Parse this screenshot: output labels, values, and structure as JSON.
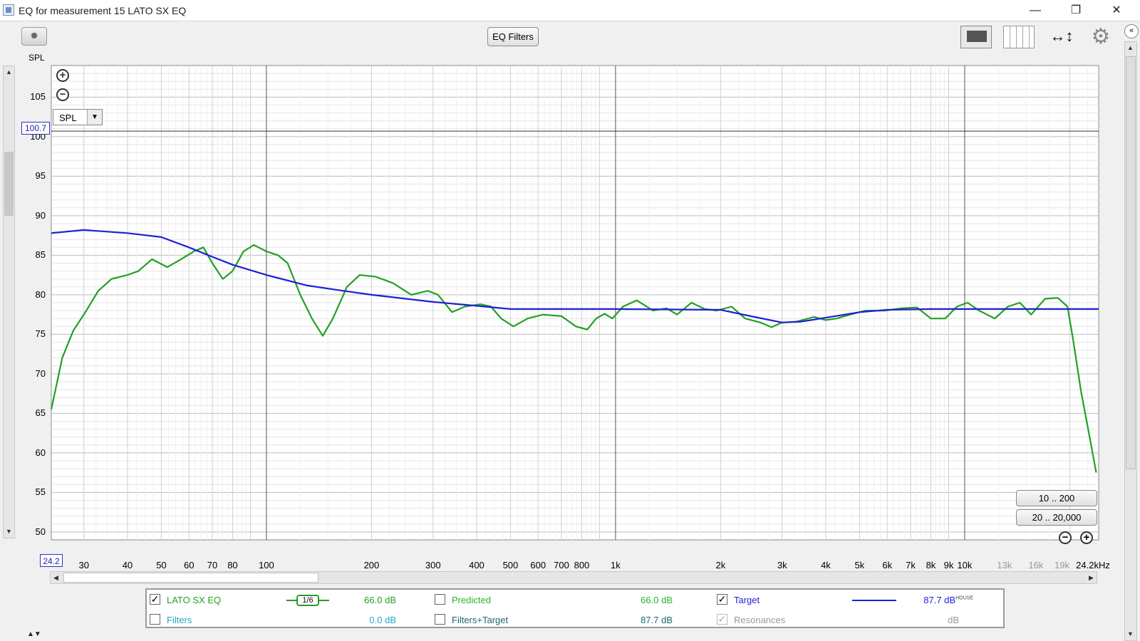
{
  "window": {
    "title": "EQ for measurement 15 LATO SX EQ",
    "controls": {
      "minimize": "—",
      "maximize": "❐",
      "close": "✕"
    }
  },
  "toolbar": {
    "eq_filters_label": "EQ Filters",
    "spl_label": "SPL",
    "icons": [
      "camera-icon",
      "layout-icon",
      "columns-icon",
      "move-arrows-icon",
      "gear-icon",
      "collapse-icon"
    ],
    "move_glyph": "↔↕",
    "gear_glyph": "⚙",
    "collapse_glyph": "«"
  },
  "plot": {
    "y_ticks": [
      "105",
      "100",
      "95",
      "90",
      "85",
      "80",
      "75",
      "70",
      "65",
      "60",
      "55",
      "50"
    ],
    "cursor_value": "100.7",
    "x_start": "24.2",
    "x_ticks": [
      {
        "label": "30",
        "f": 30,
        "dim": false
      },
      {
        "label": "40",
        "f": 40,
        "dim": false
      },
      {
        "label": "50",
        "f": 50,
        "dim": false
      },
      {
        "label": "60",
        "f": 60,
        "dim": false
      },
      {
        "label": "70",
        "f": 70,
        "dim": false
      },
      {
        "label": "80",
        "f": 80,
        "dim": false
      },
      {
        "label": "100",
        "f": 100,
        "dim": false
      },
      {
        "label": "200",
        "f": 200,
        "dim": false
      },
      {
        "label": "300",
        "f": 300,
        "dim": false
      },
      {
        "label": "400",
        "f": 400,
        "dim": false
      },
      {
        "label": "500",
        "f": 500,
        "dim": false
      },
      {
        "label": "600",
        "f": 600,
        "dim": false
      },
      {
        "label": "700",
        "f": 700,
        "dim": false
      },
      {
        "label": "800",
        "f": 800,
        "dim": false
      },
      {
        "label": "1k",
        "f": 1000,
        "dim": false
      },
      {
        "label": "2k",
        "f": 2000,
        "dim": false
      },
      {
        "label": "3k",
        "f": 3000,
        "dim": false
      },
      {
        "label": "4k",
        "f": 4000,
        "dim": false
      },
      {
        "label": "5k",
        "f": 5000,
        "dim": false
      },
      {
        "label": "6k",
        "f": 6000,
        "dim": false
      },
      {
        "label": "7k",
        "f": 7000,
        "dim": false
      },
      {
        "label": "8k",
        "f": 8000,
        "dim": false
      },
      {
        "label": "9k",
        "f": 9000,
        "dim": false
      },
      {
        "label": "10k",
        "f": 10000,
        "dim": false
      },
      {
        "label": "13k",
        "f": 13000,
        "dim": true
      },
      {
        "label": "16k",
        "f": 16000,
        "dim": true
      },
      {
        "label": "19k",
        "f": 19000,
        "dim": true
      },
      {
        "label": "24.2kHz",
        "f": 24200,
        "dim": false
      }
    ],
    "spl_dropdown": "SPL",
    "range_buttons": [
      "10 .. 200",
      "20 .. 20,000"
    ],
    "zoom_in_glyph": "+",
    "zoom_out_glyph": "−"
  },
  "chart_data": {
    "type": "line",
    "x_scale": "log",
    "xlim": [
      24.2,
      24200
    ],
    "ylim": [
      49,
      109
    ],
    "cursor_level": 100.7,
    "grid": true,
    "series": [
      {
        "name": "LATO SX EQ",
        "color": "#22a022",
        "points": [
          [
            24.2,
            65.5
          ],
          [
            26,
            72
          ],
          [
            28,
            75.5
          ],
          [
            30,
            77.5
          ],
          [
            33,
            80.5
          ],
          [
            36,
            82
          ],
          [
            40,
            82.5
          ],
          [
            43,
            83
          ],
          [
            47,
            84.5
          ],
          [
            52,
            83.5
          ],
          [
            57,
            84.5
          ],
          [
            62,
            85.5
          ],
          [
            66,
            86
          ],
          [
            70,
            84
          ],
          [
            75,
            82
          ],
          [
            80,
            83
          ],
          [
            86,
            85.5
          ],
          [
            92,
            86.3
          ],
          [
            100,
            85.5
          ],
          [
            108,
            85
          ],
          [
            115,
            84
          ],
          [
            125,
            80
          ],
          [
            135,
            77
          ],
          [
            145,
            74.8
          ],
          [
            155,
            77
          ],
          [
            170,
            81
          ],
          [
            185,
            82.5
          ],
          [
            205,
            82.3
          ],
          [
            230,
            81.5
          ],
          [
            260,
            80
          ],
          [
            290,
            80.5
          ],
          [
            310,
            80
          ],
          [
            340,
            77.8
          ],
          [
            370,
            78.5
          ],
          [
            410,
            78.8
          ],
          [
            440,
            78.5
          ],
          [
            470,
            77
          ],
          [
            510,
            76
          ],
          [
            560,
            77
          ],
          [
            620,
            77.5
          ],
          [
            700,
            77.3
          ],
          [
            770,
            76
          ],
          [
            830,
            75.6
          ],
          [
            880,
            77
          ],
          [
            930,
            77.6
          ],
          [
            980,
            77
          ],
          [
            1050,
            78.5
          ],
          [
            1150,
            79.3
          ],
          [
            1280,
            78
          ],
          [
            1400,
            78.3
          ],
          [
            1500,
            77.5
          ],
          [
            1650,
            79
          ],
          [
            1800,
            78.2
          ],
          [
            1950,
            78
          ],
          [
            2150,
            78.5
          ],
          [
            2350,
            77
          ],
          [
            2600,
            76.5
          ],
          [
            2800,
            75.9
          ],
          [
            3000,
            76.5
          ],
          [
            3300,
            76.6
          ],
          [
            3700,
            77.2
          ],
          [
            4000,
            76.8
          ],
          [
            4300,
            77
          ],
          [
            4700,
            77.5
          ],
          [
            5200,
            78
          ],
          [
            5900,
            78
          ],
          [
            6600,
            78.3
          ],
          [
            7300,
            78.4
          ],
          [
            8000,
            77
          ],
          [
            8800,
            77
          ],
          [
            9500,
            78.5
          ],
          [
            10200,
            79
          ],
          [
            11000,
            78
          ],
          [
            12200,
            77
          ],
          [
            13300,
            78.5
          ],
          [
            14400,
            79
          ],
          [
            15500,
            77.5
          ],
          [
            17000,
            79.5
          ],
          [
            18500,
            79.6
          ],
          [
            19700,
            78.5
          ],
          [
            20500,
            74
          ],
          [
            21500,
            68
          ],
          [
            22800,
            62
          ],
          [
            23800,
            57.5
          ]
        ]
      },
      {
        "name": "Target",
        "color": "#1f1fd6",
        "points": [
          [
            24.2,
            87.8
          ],
          [
            30,
            88.2
          ],
          [
            40,
            87.8
          ],
          [
            50,
            87.3
          ],
          [
            60,
            86
          ],
          [
            70,
            84.8
          ],
          [
            80,
            83.8
          ],
          [
            100,
            82.5
          ],
          [
            130,
            81.2
          ],
          [
            160,
            80.6
          ],
          [
            200,
            80
          ],
          [
            250,
            79.5
          ],
          [
            300,
            79.1
          ],
          [
            400,
            78.6
          ],
          [
            500,
            78.2
          ],
          [
            1000,
            78.2
          ],
          [
            2000,
            78.1
          ],
          [
            2500,
            77.2
          ],
          [
            3000,
            76.5
          ],
          [
            3400,
            76.6
          ],
          [
            4000,
            77.1
          ],
          [
            5000,
            77.8
          ],
          [
            6000,
            78.1
          ],
          [
            8000,
            78.2
          ],
          [
            24200,
            78.2
          ]
        ]
      }
    ]
  },
  "legend": {
    "measurement": {
      "label": "LATO SX EQ",
      "checked": true,
      "smoothing": "1/6",
      "value": "66.0 dB"
    },
    "filters": {
      "label": "Filters",
      "checked": false,
      "value": "0.0 dB"
    },
    "predicted": {
      "label": "Predicted",
      "checked": false,
      "value": "66.0 dB"
    },
    "filters_target": {
      "label": "Filters+Target",
      "checked": false,
      "value": "87.7 dB"
    },
    "target": {
      "label": "Target",
      "checked": true,
      "value": "87.7 dB",
      "superscript": "HOUSE"
    },
    "resonances": {
      "label": "Resonances",
      "checked": true,
      "value": "dB"
    },
    "check_glyph": "✓"
  },
  "colors": {
    "measurement": "#22a022",
    "target": "#1f1fd6",
    "filters": "#20a8c8",
    "predicted": "#22b822",
    "filters_target": "#1a6a6a"
  }
}
